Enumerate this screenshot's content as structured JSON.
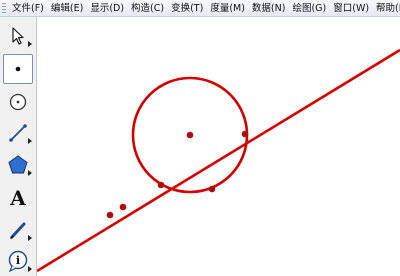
{
  "menu": {
    "items": [
      {
        "label": "文件(F)"
      },
      {
        "label": "编辑(E)"
      },
      {
        "label": "显示(D)"
      },
      {
        "label": "构造(C)"
      },
      {
        "label": "变换(T)"
      },
      {
        "label": "度量(M)"
      },
      {
        "label": "数据(N)"
      },
      {
        "label": "绘图(G)"
      },
      {
        "label": "窗口(W)"
      },
      {
        "label": "帮助(H)"
      }
    ]
  },
  "toolbar": {
    "tools": [
      {
        "name": "selection-arrow-tool",
        "icon": "arrow-pointer-icon"
      },
      {
        "name": "point-tool",
        "icon": "point-icon",
        "active": true
      },
      {
        "name": "compass-tool",
        "icon": "circle-icon"
      },
      {
        "name": "straightedge-tool",
        "icon": "segment-icon"
      },
      {
        "name": "polygon-tool",
        "icon": "pentagon-icon"
      },
      {
        "name": "text-tool",
        "icon": "text-icon",
        "label": "A"
      },
      {
        "name": "marker-tool",
        "icon": "pen-icon"
      },
      {
        "name": "information-tool",
        "icon": "info-icon"
      }
    ]
  },
  "colors": {
    "construction": "#d40000",
    "point_fill": "#8b1a1a",
    "tool_icon": "#2a4d8f"
  }
}
